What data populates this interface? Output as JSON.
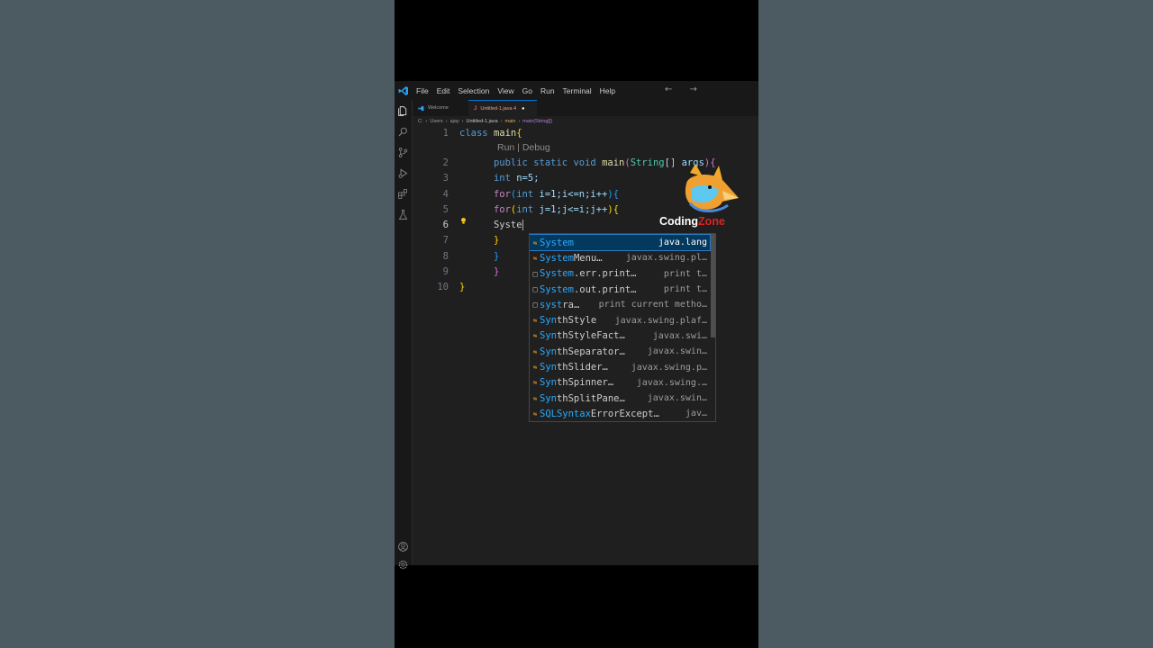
{
  "menu": [
    "File",
    "Edit",
    "Selection",
    "View",
    "Go",
    "Run",
    "Terminal",
    "Help"
  ],
  "nav": "← →",
  "tabs": {
    "welcome": "Welcome",
    "active": "Untitled-1.java 4",
    "active_dot": "●"
  },
  "breadcrumb": [
    "C:",
    "›",
    "Users",
    "›",
    "ajay",
    "›",
    "Untitled-1.java",
    "›",
    "main",
    "›",
    "main(String[])"
  ],
  "codelens": "Run | Debug",
  "line_numbers": [
    "1",
    "2",
    "3",
    "4",
    "5",
    "6",
    "7",
    "8",
    "9",
    "10"
  ],
  "code": {
    "line1_kw": "class",
    "line1_name": "main",
    "line1_brace": "{",
    "line2_mods": "public static void",
    "line2_fn": "main",
    "line2_open": "(",
    "line2_type": "String",
    "line2_arr": "[]",
    "line2_arg": "args",
    "line2_close": "){",
    "line3_type": "int",
    "line3_rest": "n=5;",
    "line4_for": "for",
    "line4_open": "(",
    "line4_type": "int",
    "line4_rest": "i=1;i<=n;i++",
    "line4_close": "){",
    "line5_for": "for",
    "line5_open": "(",
    "line5_type": "int",
    "line5_rest": "j=1;j<=i;j++",
    "line5_close": "){",
    "line6": "Syste",
    "line7": "}",
    "line8": "}",
    "line9": "}",
    "line10": "}"
  },
  "suggestions": [
    {
      "icon": "class",
      "match": "System",
      "label": "",
      "detail": "java.lang"
    },
    {
      "icon": "class",
      "match": "System",
      "label": "Menu…",
      "detail": "javax.swing.pl…"
    },
    {
      "icon": "snippet",
      "match": "System",
      "label": ".err.print…",
      "detail": "print t…"
    },
    {
      "icon": "snippet",
      "match": "System",
      "label": ".out.print…",
      "detail": "print t…"
    },
    {
      "icon": "snippet",
      "match": "syst",
      "label": "ra…",
      "detail": "print current metho…"
    },
    {
      "icon": "class",
      "match": "Syn",
      "label": "thStyle",
      "detail": "javax.swing.plaf…"
    },
    {
      "icon": "class",
      "match": "Syn",
      "label": "thStyleFact…",
      "detail": "javax.swi…"
    },
    {
      "icon": "class",
      "match": "Syn",
      "label": "thSeparator…",
      "detail": "javax.swin…"
    },
    {
      "icon": "class",
      "match": "Syn",
      "label": "thSlider…",
      "detail": "javax.swing.p…"
    },
    {
      "icon": "class",
      "match": "Syn",
      "label": "thSpinner…",
      "detail": "javax.swing.…"
    },
    {
      "icon": "class",
      "match": "Syn",
      "label": "thSplitPane…",
      "detail": "javax.swin…"
    },
    {
      "icon": "class",
      "match": "SQLSyntax",
      "label": "ErrorExcept…",
      "detail": "jav…"
    }
  ],
  "watermark": {
    "word1": "Coding",
    "word2": "Zone"
  },
  "colors": {
    "accent": "#0078d4",
    "keyword": "#569cd6",
    "type": "#4ec9b0",
    "function": "#dcdcaa",
    "variable": "#9cdcfe",
    "control": "#c586c0",
    "match": "#2aaaff"
  }
}
